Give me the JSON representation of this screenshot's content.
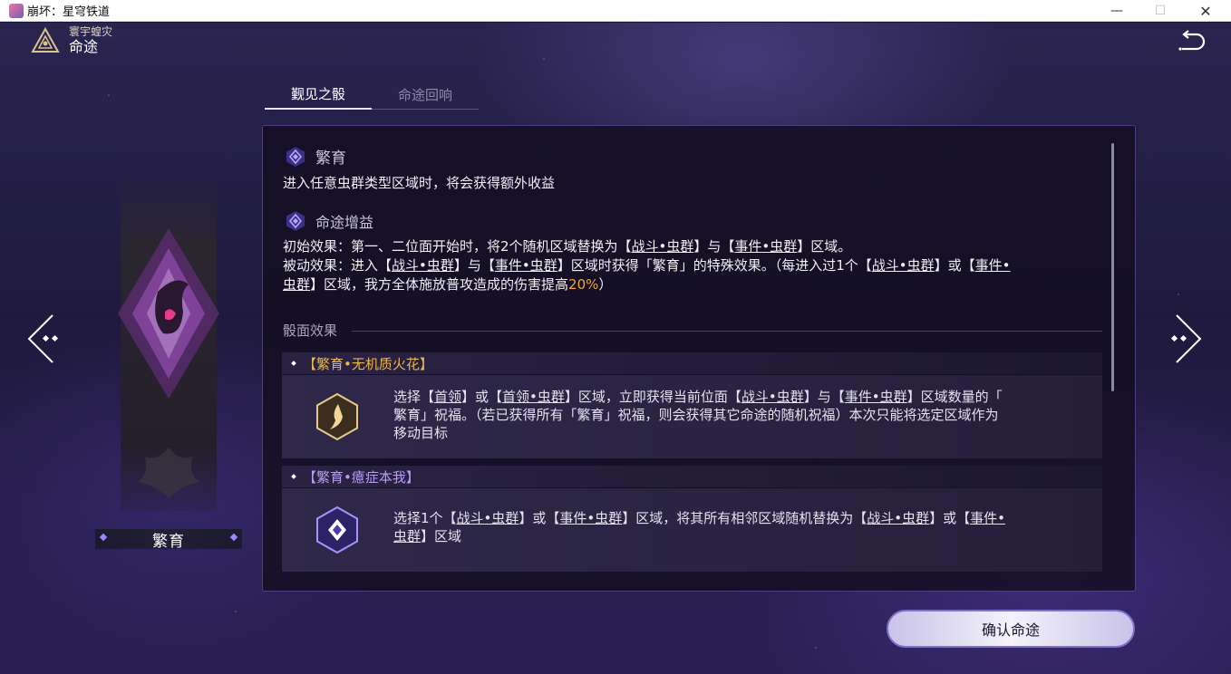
{
  "window": {
    "title": "崩坏：星穹铁道",
    "minimize": "—",
    "maximize": "☐",
    "close": "✕"
  },
  "header": {
    "subtitle": "寰宇蝗灾",
    "title": "命途"
  },
  "card": {
    "name": "繁育"
  },
  "tabs": [
    {
      "label": "觐见之骰",
      "active": true
    },
    {
      "label": "命途回响",
      "active": false
    }
  ],
  "path_section": {
    "title": "繁育",
    "description": "进入任意虫群类型区域时，将会获得额外收益"
  },
  "bonus_section": {
    "title": "命途增益",
    "line1_prefix": "初始效果：第一、二位面开始时，将2个随机区域替换为【",
    "line1_link1": "战斗•虫群",
    "line1_mid": "】与【",
    "line1_link2": "事件•虫群",
    "line1_suffix": "】区域。",
    "line2_prefix": "被动效果：进入【",
    "line2_link1": "战斗•虫群",
    "line2_mid1": "】与【",
    "line2_link2": "事件•虫群",
    "line2_mid2": "】区域时获得「繁育」的特殊效果。（每进入过1个【",
    "line2_link3": "战斗•虫群",
    "line2_mid3": "】或【",
    "line2_link4a": "事件•",
    "line3_link4b": "虫群",
    "line3_mid": "】区域，我方全体施放普攻造成的伤害提高",
    "line3_value": "20%",
    "line3_suffix": "）"
  },
  "dice": {
    "section_title": "骰面效果",
    "items": [
      {
        "name": "【繁育•无机质火花】",
        "name_color": "#e9b84a",
        "t1": "选择【",
        "l1": "首领",
        "t2": "】或【",
        "l2": "首领•虫群",
        "t3": "】区域，立即获得当前位面【",
        "l3": "战斗•虫群",
        "t4": "】与【",
        "l4": "事件•虫群",
        "t5": "】区域数量的「",
        "line2": "繁育」祝福。（若已获得所有「繁育」祝福，则会获得其它命途的随机祝福）本次只能将选定区域作为",
        "line3": "移动目标"
      },
      {
        "name": "【繁育•癔症本我】",
        "name_color": "#b99cf0",
        "t1": "选择1个【",
        "l1": "战斗•虫群",
        "t2": "】或【",
        "l2": "事件•虫群",
        "t3": "】区域，将其所有相邻区域随机替换为【",
        "l3": "战斗•虫群",
        "t4": "】或【",
        "l4a": "事件•",
        "l4b": "虫群",
        "t5": "】区域"
      }
    ]
  },
  "confirm_button": {
    "label": "确认命途"
  }
}
